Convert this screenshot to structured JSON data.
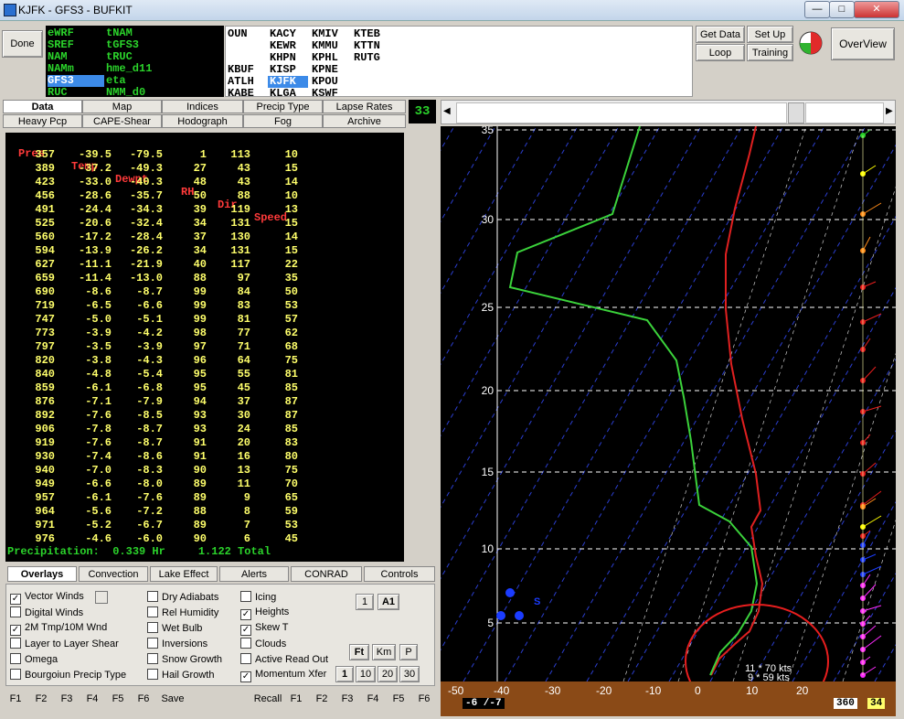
{
  "window": {
    "title": "KJFK - GFS3 - BUFKIT",
    "minimize": "—",
    "maximize": "□",
    "close": "✕"
  },
  "toolbar": {
    "done": "Done",
    "get_data": "Get Data",
    "loop": "Loop",
    "set_up": "Set Up",
    "training": "Training",
    "overview": "OverView"
  },
  "models": [
    {
      "label": "eWRF"
    },
    {
      "label": "SREF"
    },
    {
      "label": "NAM"
    },
    {
      "label": "NAMm"
    },
    {
      "label": "GFS3"
    },
    {
      "label": "RUC"
    },
    {
      "label": "tNAM"
    },
    {
      "label": "tGFS3"
    },
    {
      "label": "tRUC"
    },
    {
      "label": "hme_d11"
    },
    {
      "label": "eta"
    },
    {
      "label": "NMM_d0"
    }
  ],
  "stations": [
    "OUN",
    "KBUF",
    "ATLH",
    "KABE",
    "KACY",
    "KEWR",
    "KHPN",
    "KISP",
    "KJFK",
    "KLGA",
    "KMIV",
    "KMMU",
    "KPHL",
    "KPNE",
    "KPOU",
    "KSWF",
    "KTEB",
    "KTTN",
    "RUTG"
  ],
  "top_tabs": [
    "Data",
    "Map",
    "Indices",
    "Precip Type",
    "Lapse Rates",
    "Heavy Pcp",
    "CAPE-Shear",
    "Hodograph",
    "Fog",
    "Archive"
  ],
  "frame_counter": "33",
  "table": {
    "headers": [
      "Pres",
      "Temp",
      "Dewpt",
      "RH",
      "Dir",
      "Speed"
    ],
    "rows": [
      [
        "357",
        "-39.5",
        "-79.5",
        "1",
        "113",
        "10"
      ],
      [
        "389",
        "-37.2",
        "-49.3",
        "27",
        "43",
        "15"
      ],
      [
        "423",
        "-33.0",
        "-40.3",
        "48",
        "43",
        "14"
      ],
      [
        "456",
        "-28.6",
        "-35.7",
        "50",
        "88",
        "10"
      ],
      [
        "491",
        "-24.4",
        "-34.3",
        "39",
        "119",
        "13"
      ],
      [
        "525",
        "-20.6",
        "-32.4",
        "34",
        "131",
        "15"
      ],
      [
        "560",
        "-17.2",
        "-28.4",
        "37",
        "130",
        "14"
      ],
      [
        "594",
        "-13.9",
        "-26.2",
        "34",
        "131",
        "15"
      ],
      [
        "627",
        "-11.1",
        "-21.9",
        "40",
        "117",
        "22"
      ],
      [
        "659",
        "-11.4",
        "-13.0",
        "88",
        "97",
        "35"
      ],
      [
        "690",
        "-8.6",
        "-8.7",
        "99",
        "84",
        "50"
      ],
      [
        "719",
        "-6.5",
        "-6.6",
        "99",
        "83",
        "53"
      ],
      [
        "747",
        "-5.0",
        "-5.1",
        "99",
        "81",
        "57"
      ],
      [
        "773",
        "-3.9",
        "-4.2",
        "98",
        "77",
        "62"
      ],
      [
        "797",
        "-3.5",
        "-3.9",
        "97",
        "71",
        "68"
      ],
      [
        "820",
        "-3.8",
        "-4.3",
        "96",
        "64",
        "75"
      ],
      [
        "840",
        "-4.8",
        "-5.4",
        "95",
        "55",
        "81"
      ],
      [
        "859",
        "-6.1",
        "-6.8",
        "95",
        "45",
        "85"
      ],
      [
        "876",
        "-7.1",
        "-7.9",
        "94",
        "37",
        "87"
      ],
      [
        "892",
        "-7.6",
        "-8.5",
        "93",
        "30",
        "87"
      ],
      [
        "906",
        "-7.8",
        "-8.7",
        "93",
        "24",
        "85"
      ],
      [
        "919",
        "-7.6",
        "-8.7",
        "91",
        "20",
        "83"
      ],
      [
        "930",
        "-7.4",
        "-8.6",
        "91",
        "16",
        "80"
      ],
      [
        "940",
        "-7.0",
        "-8.3",
        "90",
        "13",
        "75"
      ],
      [
        "949",
        "-6.6",
        "-8.0",
        "89",
        "11",
        "70"
      ],
      [
        "957",
        "-6.1",
        "-7.6",
        "89",
        "9",
        "65"
      ],
      [
        "964",
        "-5.6",
        "-7.2",
        "88",
        "8",
        "59"
      ],
      [
        "971",
        "-5.2",
        "-6.7",
        "89",
        "7",
        "53"
      ],
      [
        "976",
        "-4.6",
        "-6.0",
        "90",
        "6",
        "45"
      ]
    ],
    "precip": "Precipitation:  0.339 Hr     1.122 Total"
  },
  "overlay_tabs": [
    "Overlays",
    "Convection",
    "Lake Effect",
    "Alerts",
    "CONRAD",
    "Controls"
  ],
  "overlays": {
    "col1": [
      [
        "Vector Winds",
        true
      ],
      [
        "Digital Winds",
        false
      ],
      [
        "2M Tmp/10M Wnd",
        true
      ],
      [
        "Layer to Layer Shear",
        false
      ],
      [
        "Omega",
        false
      ],
      [
        "Bourgoiun Precip Type",
        false
      ]
    ],
    "col2": [
      [
        "Dry Adiabats",
        false
      ],
      [
        "Rel Humidity",
        false
      ],
      [
        "Wet Bulb",
        false
      ],
      [
        "Inversions",
        false
      ],
      [
        "Snow Growth",
        false
      ],
      [
        "Hail Growth",
        false
      ]
    ],
    "col3": [
      [
        "Icing",
        false
      ],
      [
        "Heights",
        true
      ],
      [
        "Skew T",
        true
      ],
      [
        "Clouds",
        false
      ],
      [
        "Active Read Out",
        false
      ],
      [
        "Momentum Xfer",
        true
      ]
    ],
    "btn_1": "1",
    "btn_a1": "A1",
    "btn_ft": "Ft",
    "btn_km": "Km",
    "btn_p": "P",
    "steps": [
      "1",
      "10",
      "20",
      "30"
    ]
  },
  "fkeys_left": [
    "F1",
    "F2",
    "F3",
    "F4",
    "F5",
    "F6"
  ],
  "save": "Save",
  "recall": "Recall",
  "fkeys_right": [
    "F1",
    "F2",
    "F3",
    "F4",
    "F5",
    "F6"
  ],
  "skewt": {
    "y_labels": [
      "35",
      "30",
      "25",
      "20",
      "15",
      "10",
      "5"
    ],
    "x_labels": [
      "-50",
      "-40",
      "-30",
      "-20",
      "-10",
      "0",
      "10",
      "20"
    ],
    "annot1": "11 * 70 kts",
    "annot2": "9 * 59 kts",
    "s_label": "S",
    "temp_readout": "-6 /-7",
    "dir_readout": "360",
    "spd_readout": "34"
  },
  "colors": {
    "temp": "#e02020",
    "dewpt": "#3bd23b",
    "table_text": "#ffff6b",
    "header": "#ff3a3a",
    "ground": "#8a4a17"
  }
}
